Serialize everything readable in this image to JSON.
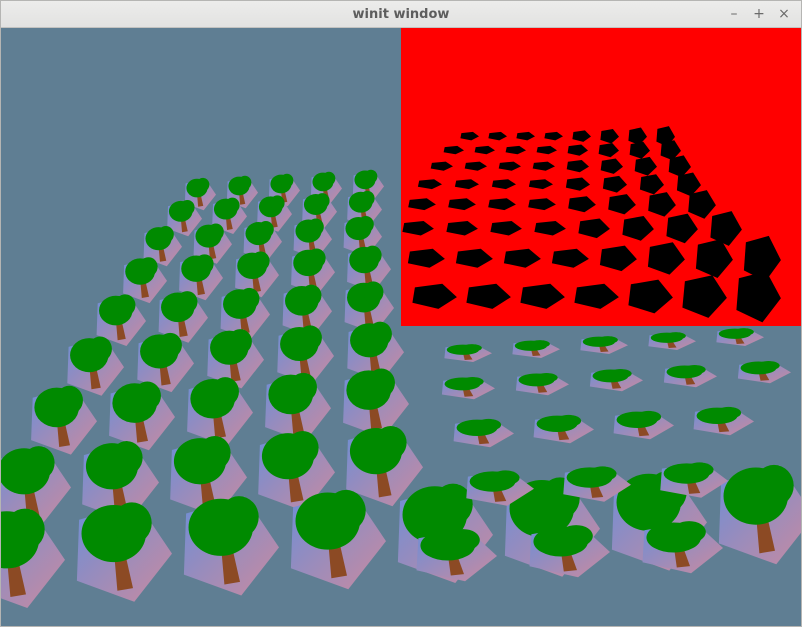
{
  "window": {
    "title": "winit window",
    "buttons": {
      "minimize": "–",
      "maximize": "+",
      "close": "×"
    }
  },
  "scene": {
    "clear_color": "#5f7e93",
    "render_target_color": "#ff0000",
    "shadow_color": "#000000",
    "foliage_color": "#008a00",
    "trunk_color": "#8c4a24",
    "tile_gradient": [
      "#6d8ed6",
      "#c98aa0"
    ],
    "instance_grid": "pentagon instances textured with a tree, drawn in 3D perspective"
  }
}
